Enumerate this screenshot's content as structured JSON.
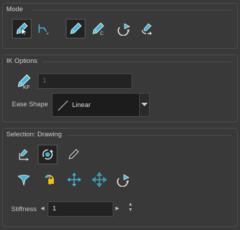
{
  "mode": {
    "title": "Mode",
    "tools": [
      {
        "icon": "transform-cursor-icon",
        "selected": true
      },
      {
        "icon": "hierarchy-icon",
        "selected": false
      },
      {
        "icon": "bone-rotate-icon",
        "selected": true
      },
      {
        "icon": "bone-constraint-icon",
        "selected": false
      },
      {
        "icon": "rotate-arrow-icon",
        "selected": false
      },
      {
        "icon": "bone-swap-icon",
        "selected": false
      }
    ]
  },
  "ik_options": {
    "title": "IK Options",
    "keyframe_value": "1",
    "ease_shape_label": "Ease Shape",
    "ease_shape_value": "Linear"
  },
  "selection": {
    "title": "Selection: Drawing",
    "row1_icons": [
      "bone-resize-icon",
      "rotate-cycle-icon",
      "bone-outline-icon"
    ],
    "row2_icons": [
      "flip-icon",
      "lock-bone-icon",
      "move-cross-icon",
      "move-cross-alt-icon",
      "rotate-arrow-icon"
    ],
    "stiffness_label": "Stiffness",
    "stiffness_value": "1"
  },
  "colors": {
    "accent": "#3fb8d8",
    "panel_bg": "#393939",
    "selected_bg": "#222222"
  }
}
